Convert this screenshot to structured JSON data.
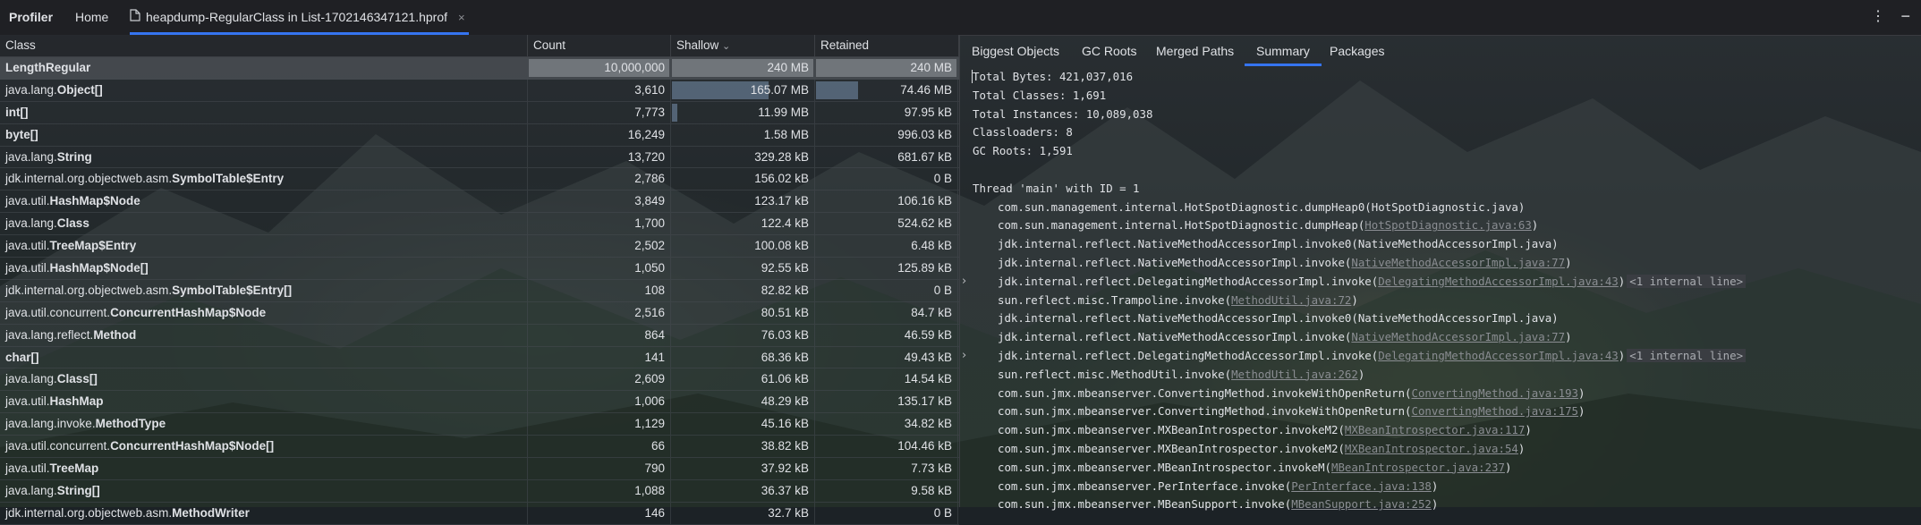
{
  "tabs": [
    {
      "label": "Profiler",
      "bold": true
    },
    {
      "label": "Home"
    },
    {
      "label": "heapdump-RegularClass in List-1702146347121.hprof",
      "close": "×",
      "active": true
    }
  ],
  "toolbar": {
    "kebab": "⋮",
    "minimize": "−"
  },
  "table": {
    "columns": {
      "class": "Class",
      "count": "Count",
      "shallow": "Shallow",
      "shallow_sort": "⌄",
      "retained": "Retained"
    },
    "rows": [
      {
        "pkg": "",
        "name": "LengthRegular",
        "count": "10,000,000",
        "shallow": "240 MB",
        "retained": "240 MB",
        "count_frac": 1.0,
        "shallow_frac": 1.0,
        "retained_frac": 1.0,
        "selected": true
      },
      {
        "pkg": "java.lang.",
        "name": "Object[]",
        "count": "3,610",
        "shallow": "165.07 MB",
        "retained": "74.46 MB",
        "count_frac": 0,
        "shallow_frac": 0.69,
        "retained_frac": 0.31
      },
      {
        "pkg": "",
        "name": "int[]",
        "count": "7,773",
        "shallow": "11.99 MB",
        "retained": "97.95 kB",
        "count_frac": 0,
        "shallow_frac": 0.05,
        "retained_frac": 0
      },
      {
        "pkg": "",
        "name": "byte[]",
        "count": "16,249",
        "shallow": "1.58 MB",
        "retained": "996.03 kB",
        "count_frac": 0,
        "shallow_frac": 0,
        "retained_frac": 0
      },
      {
        "pkg": "java.lang.",
        "name": "String",
        "count": "13,720",
        "shallow": "329.28 kB",
        "retained": "681.67 kB",
        "count_frac": 0,
        "shallow_frac": 0,
        "retained_frac": 0
      },
      {
        "pkg": "jdk.internal.org.objectweb.asm.",
        "name": "SymbolTable$Entry",
        "count": "2,786",
        "shallow": "156.02 kB",
        "retained": "0 B",
        "count_frac": 0,
        "shallow_frac": 0,
        "retained_frac": 0
      },
      {
        "pkg": "java.util.",
        "name": "HashMap$Node",
        "count": "3,849",
        "shallow": "123.17 kB",
        "retained": "106.16 kB",
        "count_frac": 0,
        "shallow_frac": 0,
        "retained_frac": 0
      },
      {
        "pkg": "java.lang.",
        "name": "Class",
        "count": "1,700",
        "shallow": "122.4 kB",
        "retained": "524.62 kB",
        "count_frac": 0,
        "shallow_frac": 0,
        "retained_frac": 0
      },
      {
        "pkg": "java.util.",
        "name": "TreeMap$Entry",
        "count": "2,502",
        "shallow": "100.08 kB",
        "retained": "6.48 kB",
        "count_frac": 0,
        "shallow_frac": 0,
        "retained_frac": 0
      },
      {
        "pkg": "java.util.",
        "name": "HashMap$Node[]",
        "count": "1,050",
        "shallow": "92.55 kB",
        "retained": "125.89 kB",
        "count_frac": 0,
        "shallow_frac": 0,
        "retained_frac": 0
      },
      {
        "pkg": "jdk.internal.org.objectweb.asm.",
        "name": "SymbolTable$Entry[]",
        "count": "108",
        "shallow": "82.82 kB",
        "retained": "0 B",
        "count_frac": 0,
        "shallow_frac": 0,
        "retained_frac": 0
      },
      {
        "pkg": "java.util.concurrent.",
        "name": "ConcurrentHashMap$Node",
        "count": "2,516",
        "shallow": "80.51 kB",
        "retained": "84.7 kB",
        "count_frac": 0,
        "shallow_frac": 0,
        "retained_frac": 0
      },
      {
        "pkg": "java.lang.reflect.",
        "name": "Method",
        "count": "864",
        "shallow": "76.03 kB",
        "retained": "46.59 kB",
        "count_frac": 0,
        "shallow_frac": 0,
        "retained_frac": 0
      },
      {
        "pkg": "",
        "name": "char[]",
        "count": "141",
        "shallow": "68.36 kB",
        "retained": "49.43 kB",
        "count_frac": 0,
        "shallow_frac": 0,
        "retained_frac": 0
      },
      {
        "pkg": "java.lang.",
        "name": "Class[]",
        "count": "2,609",
        "shallow": "61.06 kB",
        "retained": "14.54 kB",
        "count_frac": 0,
        "shallow_frac": 0,
        "retained_frac": 0
      },
      {
        "pkg": "java.util.",
        "name": "HashMap",
        "count": "1,006",
        "shallow": "48.29 kB",
        "retained": "135.17 kB",
        "count_frac": 0,
        "shallow_frac": 0,
        "retained_frac": 0
      },
      {
        "pkg": "java.lang.invoke.",
        "name": "MethodType",
        "count": "1,129",
        "shallow": "45.16 kB",
        "retained": "34.82 kB",
        "count_frac": 0,
        "shallow_frac": 0,
        "retained_frac": 0
      },
      {
        "pkg": "java.util.concurrent.",
        "name": "ConcurrentHashMap$Node[]",
        "count": "66",
        "shallow": "38.82 kB",
        "retained": "104.46 kB",
        "count_frac": 0,
        "shallow_frac": 0,
        "retained_frac": 0
      },
      {
        "pkg": "java.util.",
        "name": "TreeMap",
        "count": "790",
        "shallow": "37.92 kB",
        "retained": "7.73 kB",
        "count_frac": 0,
        "shallow_frac": 0,
        "retained_frac": 0
      },
      {
        "pkg": "java.lang.",
        "name": "String[]",
        "count": "1,088",
        "shallow": "36.37 kB",
        "retained": "9.58 kB",
        "count_frac": 0,
        "shallow_frac": 0,
        "retained_frac": 0
      },
      {
        "pkg": "jdk.internal.org.objectweb.asm.",
        "name": "MethodWriter",
        "count": "146",
        "shallow": "32.7 kB",
        "retained": "0 B",
        "count_frac": 0,
        "shallow_frac": 0,
        "retained_frac": 0
      }
    ]
  },
  "right_tabs": [
    {
      "label": "Biggest Objects"
    },
    {
      "label": "GC Roots"
    },
    {
      "label": "Merged Paths"
    },
    {
      "label": "Summary",
      "active": true
    },
    {
      "label": "Packages"
    }
  ],
  "summary": {
    "lines": [
      "Total Bytes: 421,037,016",
      "Total Classes: 1,691",
      "Total Instances: 10,089,038",
      "Classloaders: 8",
      "GC Roots: 1,591"
    ],
    "thread_header": "Thread 'main' with ID = 1",
    "frames": [
      {
        "text": "com.sun.management.internal.HotSpotDiagnostic.dumpHeap0(HotSpotDiagnostic.java)"
      },
      {
        "text": "com.sun.management.internal.HotSpotDiagnostic.dumpHeap(",
        "link": "HotSpotDiagnostic.java:63",
        "tail": ")"
      },
      {
        "text": "jdk.internal.reflect.NativeMethodAccessorImpl.invoke0(NativeMethodAccessorImpl.java)"
      },
      {
        "text": "jdk.internal.reflect.NativeMethodAccessorImpl.invoke(",
        "link": "NativeMethodAccessorImpl.java:77",
        "tail": ")"
      },
      {
        "text": "jdk.internal.reflect.DelegatingMethodAccessorImpl.invoke(",
        "link": "DelegatingMethodAccessorImpl.java:43",
        "tail": ")",
        "hint": "<1 internal line>",
        "chevron": "›"
      },
      {
        "text": "sun.reflect.misc.Trampoline.invoke(",
        "link": "MethodUtil.java:72",
        "tail": ")"
      },
      {
        "text": "jdk.internal.reflect.NativeMethodAccessorImpl.invoke0(NativeMethodAccessorImpl.java)"
      },
      {
        "text": "jdk.internal.reflect.NativeMethodAccessorImpl.invoke(",
        "link": "NativeMethodAccessorImpl.java:77",
        "tail": ")"
      },
      {
        "text": "jdk.internal.reflect.DelegatingMethodAccessorImpl.invoke(",
        "link": "DelegatingMethodAccessorImpl.java:43",
        "tail": ")",
        "hint": "<1 internal line>",
        "chevron": "›"
      },
      {
        "text": "sun.reflect.misc.MethodUtil.invoke(",
        "link": "MethodUtil.java:262",
        "tail": ")"
      },
      {
        "text": "com.sun.jmx.mbeanserver.ConvertingMethod.invokeWithOpenReturn(",
        "link": "ConvertingMethod.java:193",
        "tail": ")"
      },
      {
        "text": "com.sun.jmx.mbeanserver.ConvertingMethod.invokeWithOpenReturn(",
        "link": "ConvertingMethod.java:175",
        "tail": ")"
      },
      {
        "text": "com.sun.jmx.mbeanserver.MXBeanIntrospector.invokeM2(",
        "link": "MXBeanIntrospector.java:117",
        "tail": ")"
      },
      {
        "text": "com.sun.jmx.mbeanserver.MXBeanIntrospector.invokeM2(",
        "link": "MXBeanIntrospector.java:54",
        "tail": ")"
      },
      {
        "text": "com.sun.jmx.mbeanserver.MBeanIntrospector.invokeM(",
        "link": "MBeanIntrospector.java:237",
        "tail": ")"
      },
      {
        "text": "com.sun.jmx.mbeanserver.PerInterface.invoke(",
        "link": "PerInterface.java:138",
        "tail": ")"
      },
      {
        "text": "com.sun.jmx.mbeanserver.MBeanSupport.invoke(",
        "link": "MBeanSupport.java:252",
        "tail": ")"
      }
    ]
  },
  "icons": {
    "file": "file-icon",
    "sort": "sort-desc-icon",
    "chevron": "chevron-right-icon"
  },
  "colors": {
    "accent": "#3574f0",
    "link": "#8a8d92",
    "bar_gray": "#96999f",
    "bar_blue": "#7891af"
  }
}
